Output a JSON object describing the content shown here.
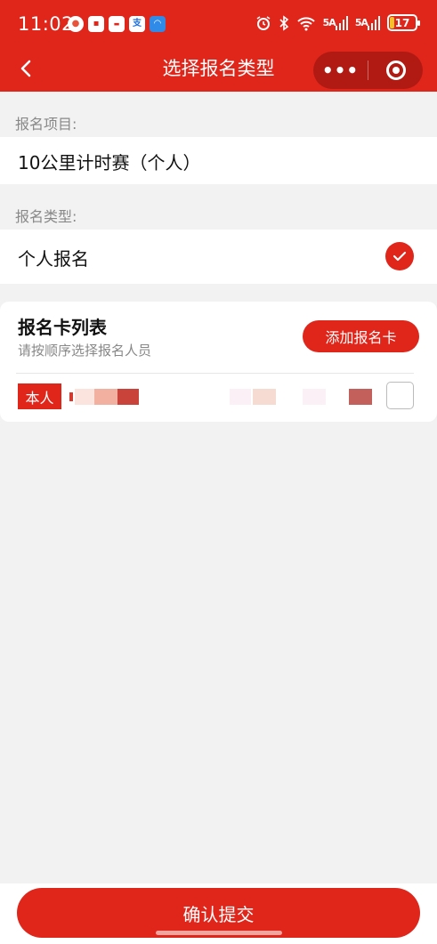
{
  "status_bar": {
    "time": "11:02",
    "battery_level": "17",
    "signal_1": "5A",
    "signal_2": "5A",
    "app_icons": [
      "browser-icon",
      "video-icon",
      "news-icon",
      "alipay-icon",
      "wifi-app-icon"
    ]
  },
  "nav": {
    "title": "选择报名类型",
    "more_label": "•••"
  },
  "form": {
    "project_label": "报名项目:",
    "project_value": "10公里计时赛（个人）",
    "type_label": "报名类型:",
    "type_value": "个人报名",
    "type_selected": true
  },
  "card_list": {
    "title": "报名卡列表",
    "subtitle": "请按顺序选择报名人员",
    "add_button": "添加报名卡",
    "items": [
      {
        "tag": "本人",
        "name_redacted": true,
        "checked": false
      }
    ]
  },
  "footer": {
    "submit_button": "确认提交"
  },
  "colors": {
    "brand_red": "#e0261b",
    "background": "#f2f2f2"
  }
}
